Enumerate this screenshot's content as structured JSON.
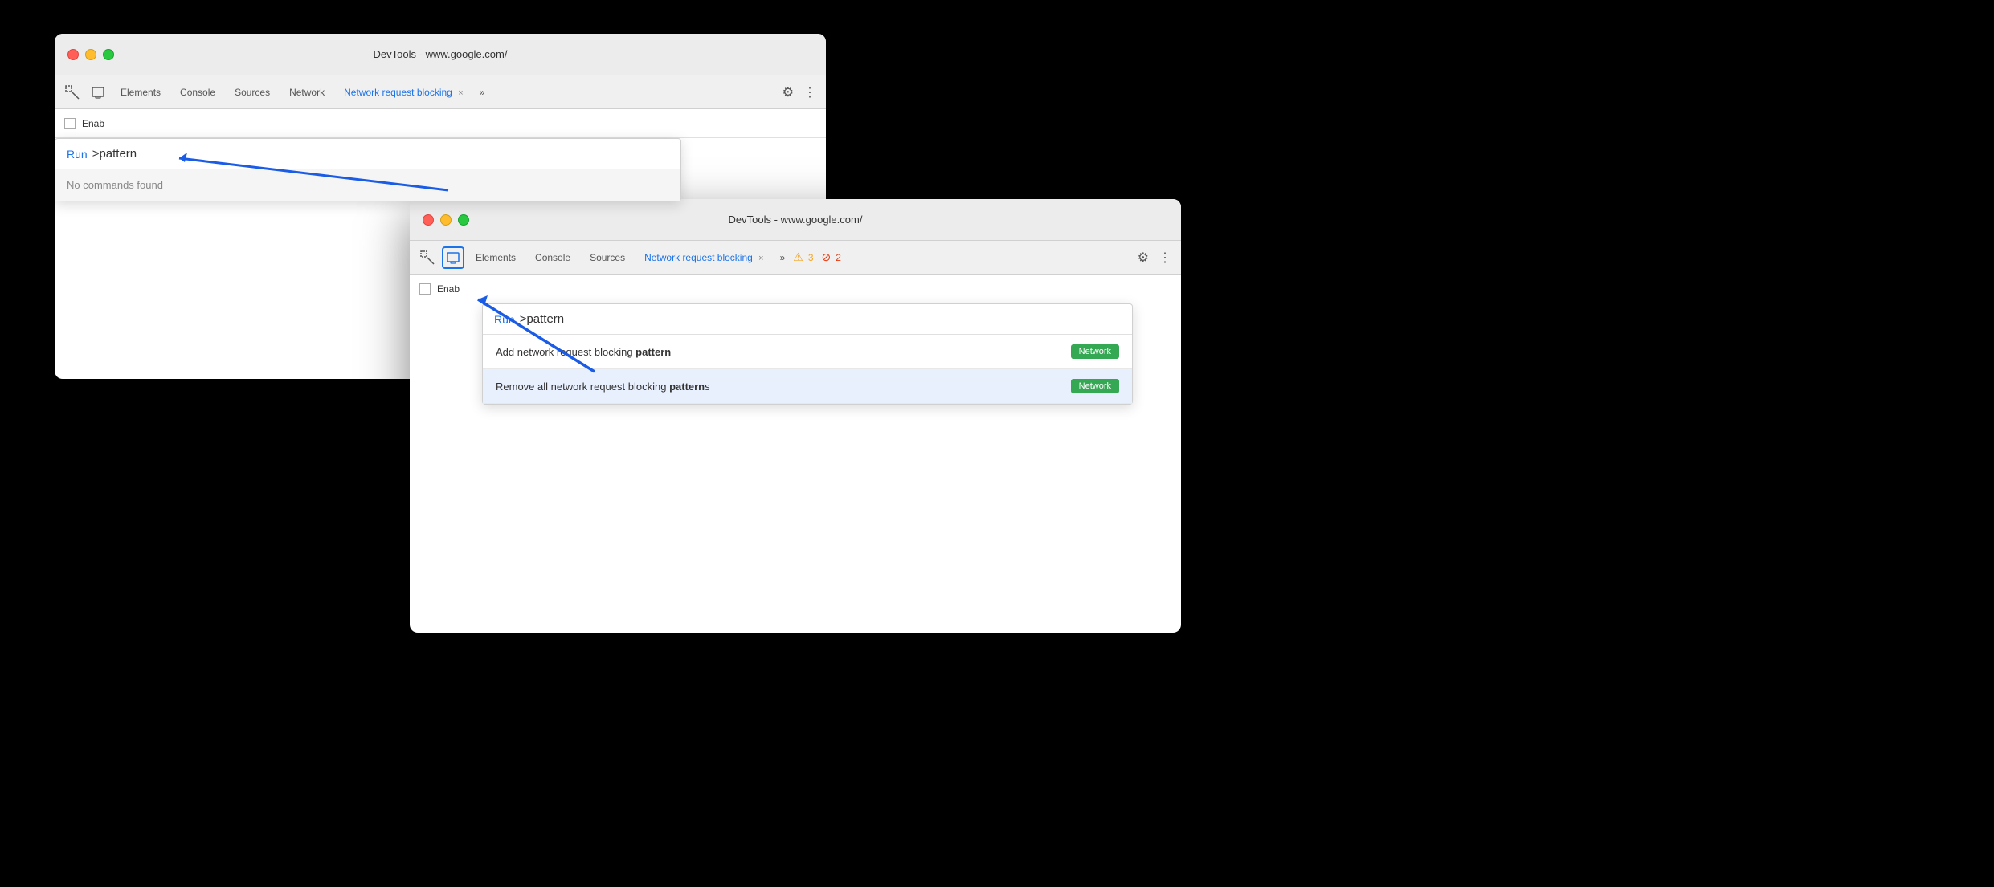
{
  "window1": {
    "title": "DevTools - www.google.com/",
    "tabs": [
      {
        "label": "Elements",
        "active": false
      },
      {
        "label": "Console",
        "active": false
      },
      {
        "label": "Sources",
        "active": false
      },
      {
        "label": "Network",
        "active": false
      },
      {
        "label": "Network request blocking",
        "active": true
      }
    ],
    "enable_label": "Enab",
    "command_palette": {
      "run_label": "Run",
      "pattern_text": ">pattern",
      "no_results": "No commands found"
    }
  },
  "window2": {
    "title": "DevTools - www.google.com/",
    "tabs": [
      {
        "label": "Elements",
        "active": false
      },
      {
        "label": "Console",
        "active": false
      },
      {
        "label": "Sources",
        "active": false
      },
      {
        "label": "Network request blocking",
        "active": true
      }
    ],
    "enable_label": "Enab",
    "badge_warning_count": "3",
    "badge_error_count": "2",
    "command_palette": {
      "run_label": "Run",
      "pattern_text": ">pattern",
      "results": [
        {
          "text_before": "Add network request blocking ",
          "text_bold": "pattern",
          "text_after": "",
          "badge": "Network",
          "selected": false
        },
        {
          "text_before": "Remove all network request blocking ",
          "text_bold": "pattern",
          "text_after": "s",
          "badge": "Network",
          "selected": true
        }
      ]
    }
  },
  "icons": {
    "inspect": "⬚",
    "device": "⊡",
    "gear": "⚙",
    "dots": "⋮",
    "more": "»",
    "warning": "⚠",
    "error": "⊘"
  }
}
